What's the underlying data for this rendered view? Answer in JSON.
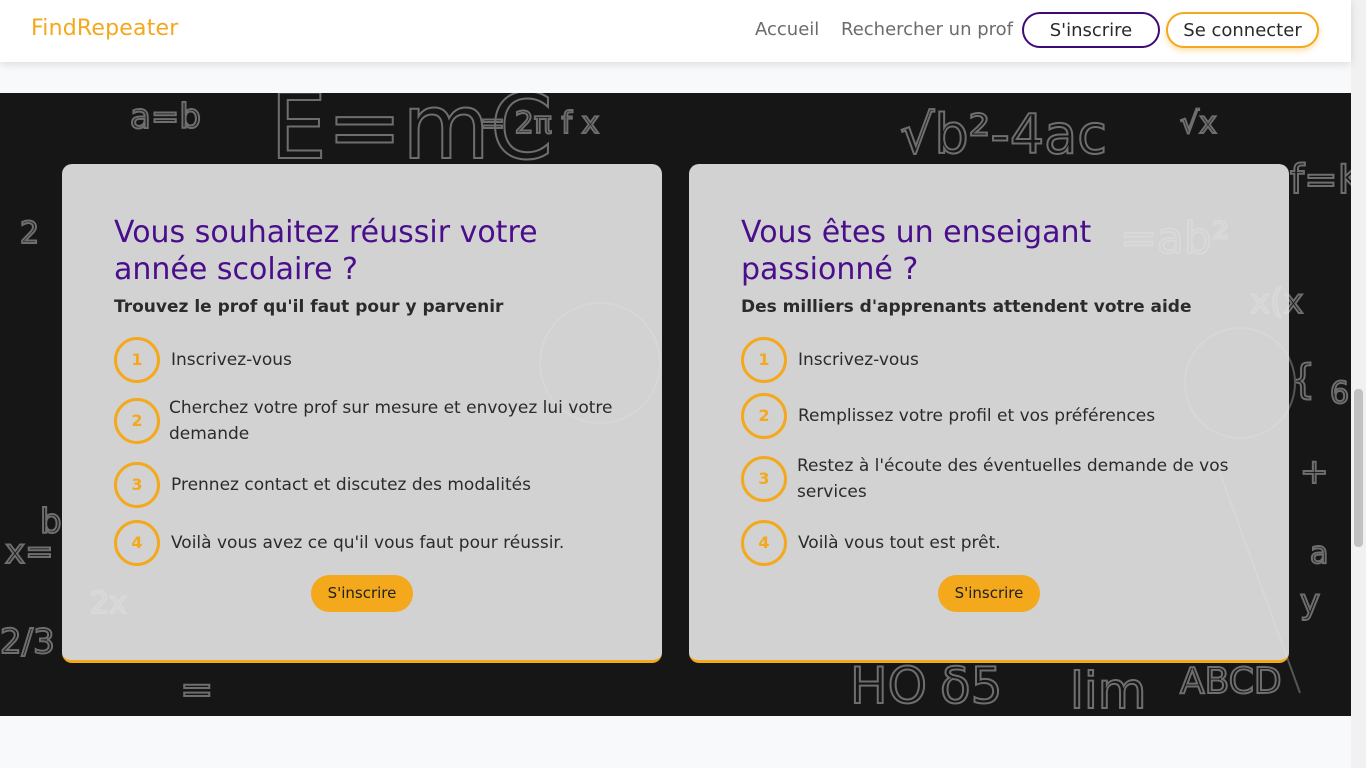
{
  "nav": {
    "brand": "FindRepeater",
    "links": [
      "Accueil",
      "Rechercher un prof"
    ],
    "signup_label": "S'inscrire",
    "login_label": "Se connecter"
  },
  "cards": [
    {
      "title": "Vous souhaitez réussir votre année scolaire ?",
      "subtitle": "Trouvez le prof qu'il faut pour y parvenir",
      "steps": [
        {
          "num": "1",
          "text": "Inscrivez-vous"
        },
        {
          "num": "2",
          "text": "Cherchez votre prof sur mesure et envoyez lui votre demande"
        },
        {
          "num": "3",
          "text": "Prennez contact et discutez des modalités"
        },
        {
          "num": "4",
          "text": "Voilà vous avez ce qu'il vous faut pour réussir."
        }
      ],
      "button_label": "S'inscrire"
    },
    {
      "title": "Vous êtes un enseigant passionné ?",
      "subtitle": "Des milliers d'apprenants attendent votre aide",
      "steps": [
        {
          "num": "1",
          "text": "Inscrivez-vous"
        },
        {
          "num": "2",
          "text": "Remplissez votre profil et vos préférences"
        },
        {
          "num": "3",
          "text": "Restez à l'écoute des éventuelles demande de vos services"
        },
        {
          "num": "4",
          "text": "Voilà vous tout est prêt."
        }
      ],
      "button_label": "S'inscrire"
    }
  ],
  "colors": {
    "accent": "#f4a81c",
    "title_purple": "#4a0e8c",
    "hero_bg": "#161616"
  }
}
